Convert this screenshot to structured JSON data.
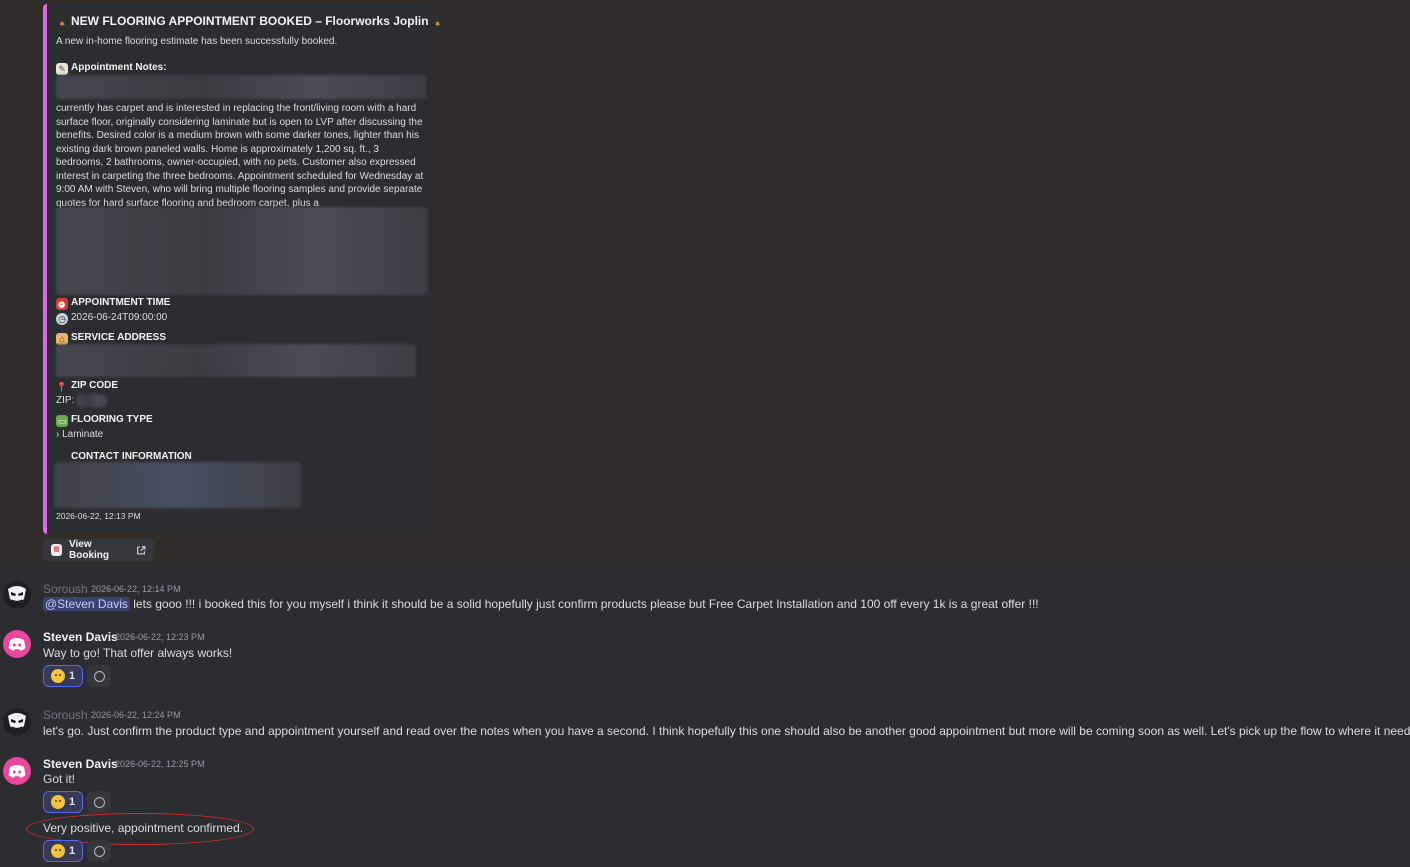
{
  "embed": {
    "title": "NEW FLOORING APPOINTMENT BOOKED – Floorworks Joplin",
    "description": "A new in-home flooring estimate has been successfully booked.",
    "notes_title": "Appointment Notes:",
    "notes_body": "currently has carpet and is interested in replacing the front/living room with a hard surface floor, originally considering laminate but is open to LVP after discussing the benefits. Desired color is a medium brown with some darker tones, lighter than his existing dark brown paneled walls. Home is approximately 1,200 sq. ft., 3 bedrooms, 2 bathrooms, owner-occupied, with no pets. Customer also expressed interest in carpeting the three bedrooms. Appointment scheduled for Wednesday at 9:00 AM with Steven, who will bring multiple flooring samples and provide separate quotes for hard surface flooring and bedroom carpet, plus a",
    "appt_time_title": "APPOINTMENT TIME",
    "appt_time_value": "2026-06-24T09:00:00",
    "service_address_title": "SERVICE ADDRESS",
    "zip_title": "ZIP CODE",
    "zip_label": "ZIP:",
    "flooring_type_title": "FLOORING TYPE",
    "flooring_type_value": "› Laminate",
    "contact_title": "CONTACT INFORMATION",
    "footer_timestamp": "2026-06-22, 12:13 PM",
    "accent_color": "#e466e8"
  },
  "view_booking_button": "View Booking",
  "messages": [
    {
      "author": "Soroush",
      "timestamp": "2026-06-22, 12:14 PM",
      "mention": "@Steven Davis",
      "text": " lets gooo !!! i booked this for you myself i think it should be a solid hopefully just confirm products please but Free Carpet Installation and 100 off every 1k is a great offer !!!"
    },
    {
      "author": "Steven Davis",
      "timestamp": "2026-06-22, 12:23 PM",
      "text": "Way to go! That offer always works!",
      "reaction_count": "1"
    },
    {
      "author": "Soroush",
      "timestamp": "2026-06-22, 12:24 PM",
      "text": "let's go. Just confirm the product type and appointment yourself and read over the notes when you have a second. I think hopefully this one should also be another good appointment but more will be coming soon as well. Let's pick up the flow to where it needs to be."
    },
    {
      "author": "Steven Davis",
      "timestamp": "2026-06-22, 12:25 PM",
      "text": "Got it!",
      "reaction_count": "1",
      "followup_text": "Very positive, appointment confirmed.",
      "followup_reaction_count": "1"
    }
  ]
}
